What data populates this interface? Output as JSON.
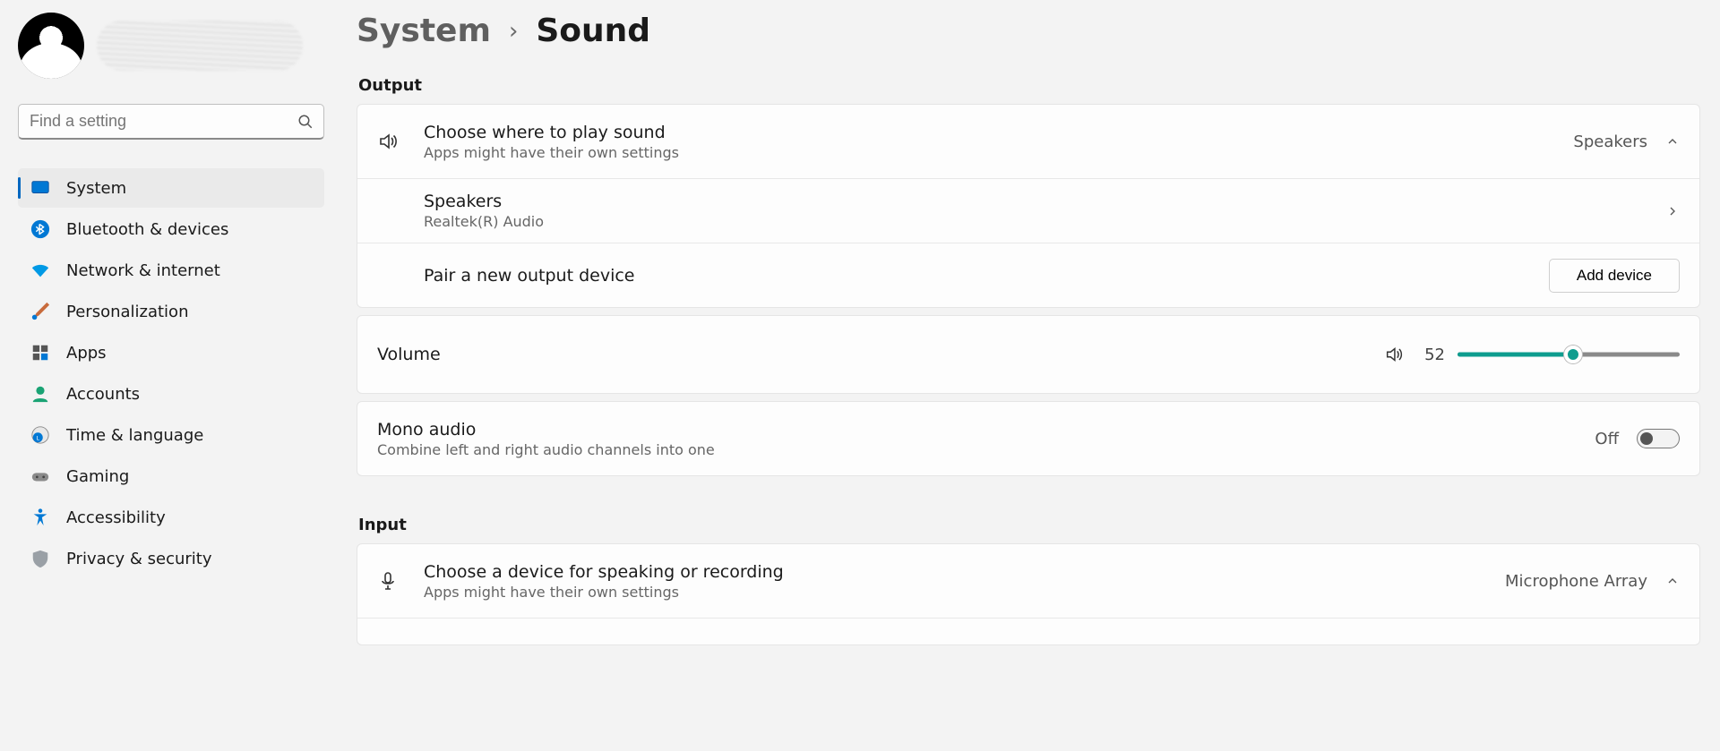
{
  "search": {
    "placeholder": "Find a setting"
  },
  "nav": {
    "items": [
      {
        "label": "System"
      },
      {
        "label": "Bluetooth & devices"
      },
      {
        "label": "Network & internet"
      },
      {
        "label": "Personalization"
      },
      {
        "label": "Apps"
      },
      {
        "label": "Accounts"
      },
      {
        "label": "Time & language"
      },
      {
        "label": "Gaming"
      },
      {
        "label": "Accessibility"
      },
      {
        "label": "Privacy & security"
      }
    ]
  },
  "breadcrumb": {
    "parent": "System",
    "current": "Sound"
  },
  "output": {
    "section": "Output",
    "choose": {
      "title": "Choose where to play sound",
      "sub": "Apps might have their own settings",
      "value": "Speakers"
    },
    "device": {
      "title": "Speakers",
      "sub": "Realtek(R) Audio"
    },
    "pair": {
      "title": "Pair a new output device",
      "button": "Add device"
    },
    "volume": {
      "title": "Volume",
      "value": "52",
      "percent": 52
    },
    "mono": {
      "title": "Mono audio",
      "sub": "Combine left and right audio channels into one",
      "state": "Off"
    }
  },
  "input": {
    "section": "Input",
    "choose": {
      "title": "Choose a device for speaking or recording",
      "sub": "Apps might have their own settings",
      "value": "Microphone Array"
    }
  }
}
